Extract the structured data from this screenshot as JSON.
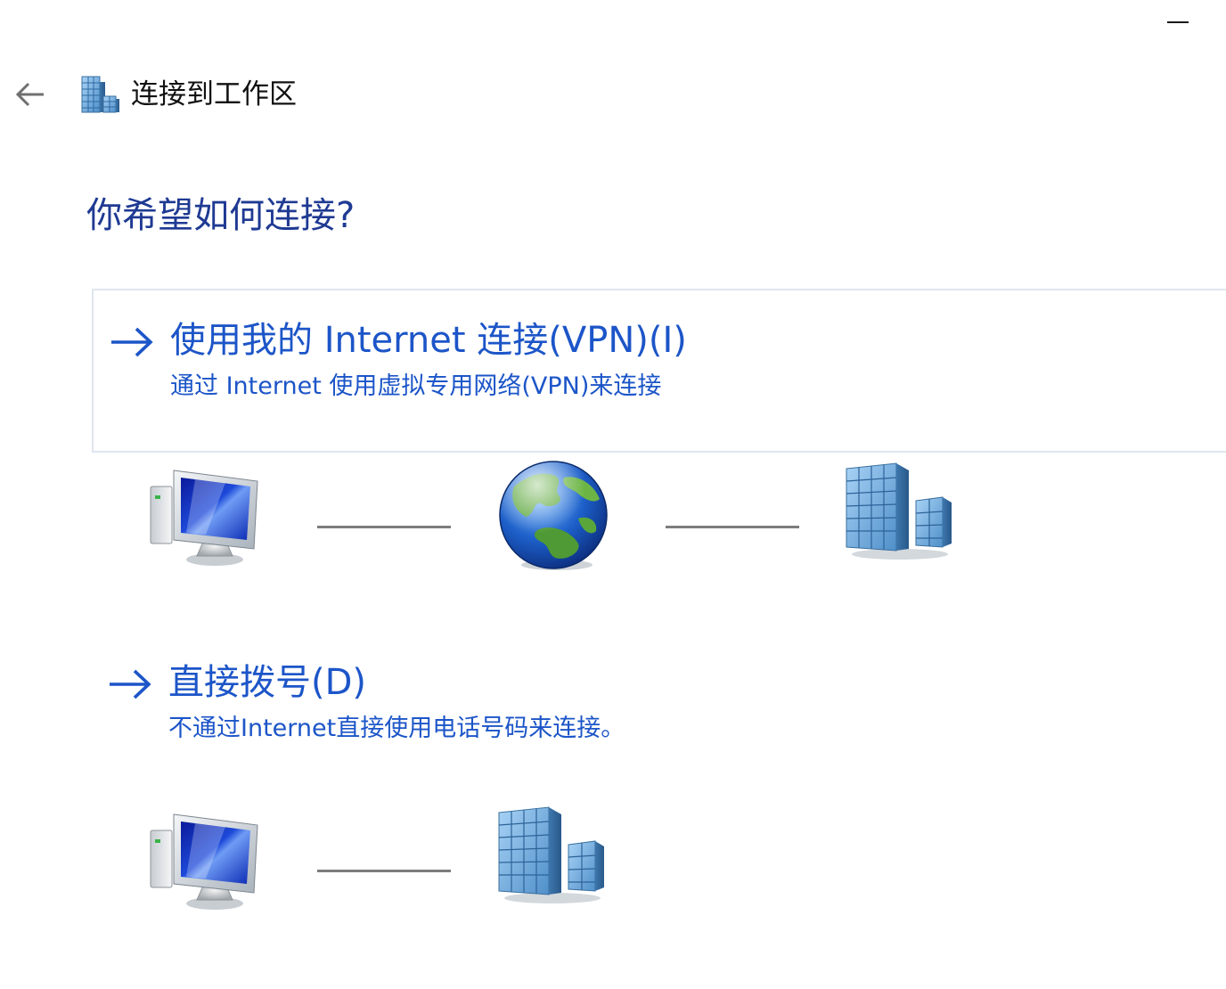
{
  "window": {
    "minimize_label": "—"
  },
  "header": {
    "title": "连接到工作区",
    "back_icon": "back-arrow-icon",
    "app_icon": "workplace-building-icon"
  },
  "main": {
    "heading": "你希望如何连接?",
    "options": [
      {
        "title": "使用我的 Internet 连接(VPN)(I)",
        "description": "通过 Internet 使用虚拟专用网络(VPN)来连接",
        "icon": "arrow-right-icon",
        "diagram": [
          "computer-icon",
          "globe-icon",
          "building-icon"
        ]
      },
      {
        "title": "直接拨号(D)",
        "description": "不通过Internet直接使用电话号码来连接。",
        "icon": "arrow-right-icon",
        "diagram": [
          "computer-icon",
          "building-icon"
        ]
      }
    ]
  },
  "colors": {
    "heading": "#1f3a93",
    "link": "#1c55c8",
    "border": "#dfe6ef",
    "connector": "#7d7d7d"
  }
}
